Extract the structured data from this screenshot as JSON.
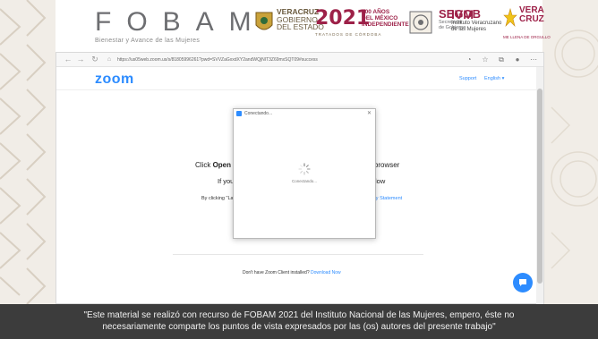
{
  "banner": {
    "fobam_letters": "FOBAM",
    "fobam_tagline": "Bienestar y Avance de las Mujeres",
    "veracruz_lines": [
      "VERACRUZ",
      "GOBIERNO",
      "DEL ESTADO"
    ],
    "mexico_year": "2021",
    "mexico_lines": [
      "200 AÑOS",
      "DEL MÉXICO",
      "INDEPENDIENTE"
    ],
    "mexico_sub": "TRATADOS DE CÓRDOBA",
    "segob_title": "SEGOB",
    "segob_sub": [
      "Secretaría",
      "de Gobierno"
    ],
    "ivm_title": "IVM",
    "ivm_sub": [
      "Instituto Veracruzano",
      "de las Mujeres"
    ],
    "vc_word": [
      "VERA",
      "CRUZ"
    ],
    "vc_tag": "ME LLENA DE ORGULLO",
    "accent_color": "#9d2148"
  },
  "browser": {
    "url": "https://us05web.zoom.us/s/81805996261?pwd=SVVZaGxxdXY2andWQjNIT3Z69mxSQT09#success",
    "icons": [
      "back-icon",
      "forward-icon",
      "refresh-icon",
      "lock-icon",
      "reader-icon",
      "favorite-icon",
      "collections-icon",
      "profile-icon",
      "more-icon"
    ]
  },
  "zoom": {
    "logo": "zoom",
    "support_link": "Support",
    "language_link": "English ▾",
    "launch_prefix": "Click ",
    "launch_bold": "Open",
    "launch_suffix": "r browser",
    "if_you": "If you",
    "low": "low",
    "by_clicking": "By clicking \"Laun",
    "privacy_statement": "acy Statement",
    "footer_text": "Don't have Zoom Client installed? ",
    "footer_link": "Download Now",
    "brand_color": "#2d8cff"
  },
  "dialog": {
    "title": "Conectando...",
    "message": "Conectando..."
  },
  "caption": {
    "line1": "\"Este material se realizó con recurso de FOBAM 2021 del Instituto Nacional de las Mujeres, empero, éste no",
    "line2": "necesariamente comparte los puntos de vista expresados por las (os) autores del presente trabajo\""
  }
}
